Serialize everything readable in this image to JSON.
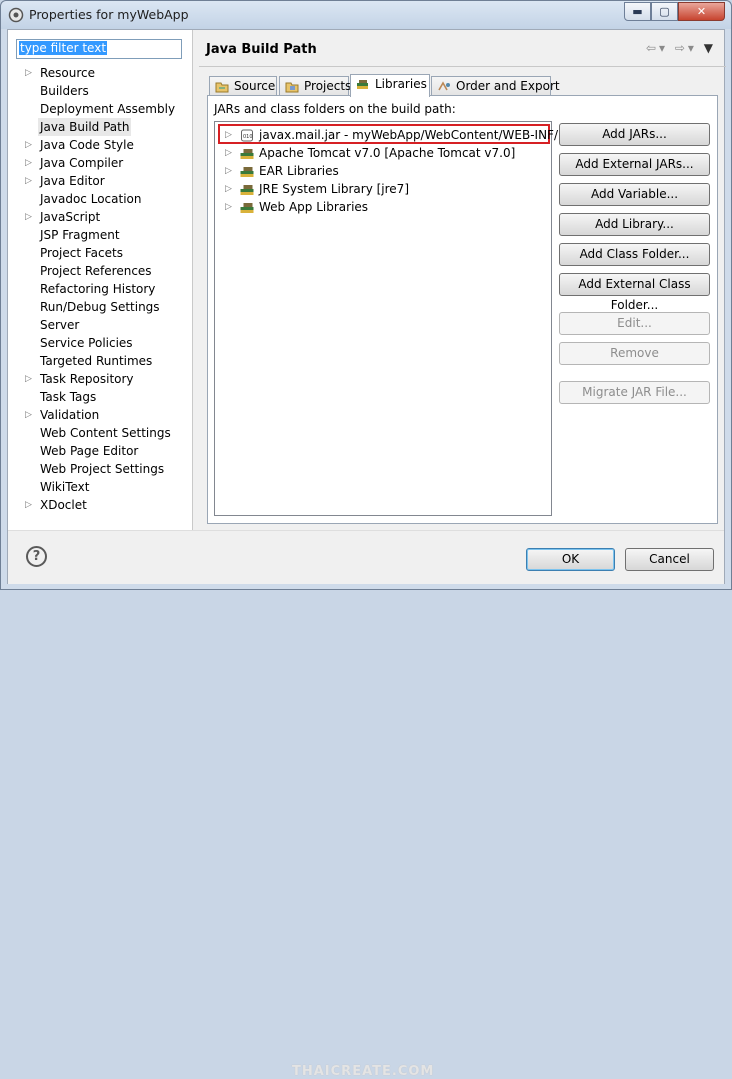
{
  "window": {
    "title": "Properties for myWebApp",
    "min_label": "▬",
    "max_label": "▢",
    "close_label": "✕"
  },
  "filter": {
    "value": "type filter text"
  },
  "tree": {
    "items": [
      {
        "label": "Resource",
        "expandable": true
      },
      {
        "label": "Builders",
        "expandable": false
      },
      {
        "label": "Deployment Assembly",
        "expandable": false
      },
      {
        "label": "Java Build Path",
        "expandable": false,
        "selected": true
      },
      {
        "label": "Java Code Style",
        "expandable": true
      },
      {
        "label": "Java Compiler",
        "expandable": true
      },
      {
        "label": "Java Editor",
        "expandable": true
      },
      {
        "label": "Javadoc Location",
        "expandable": false
      },
      {
        "label": "JavaScript",
        "expandable": true
      },
      {
        "label": "JSP Fragment",
        "expandable": false
      },
      {
        "label": "Project Facets",
        "expandable": false
      },
      {
        "label": "Project References",
        "expandable": false
      },
      {
        "label": "Refactoring History",
        "expandable": false
      },
      {
        "label": "Run/Debug Settings",
        "expandable": false
      },
      {
        "label": "Server",
        "expandable": false
      },
      {
        "label": "Service Policies",
        "expandable": false
      },
      {
        "label": "Targeted Runtimes",
        "expandable": false
      },
      {
        "label": "Task Repository",
        "expandable": true
      },
      {
        "label": "Task Tags",
        "expandable": false
      },
      {
        "label": "Validation",
        "expandable": true
      },
      {
        "label": "Web Content Settings",
        "expandable": false
      },
      {
        "label": "Web Page Editor",
        "expandable": false
      },
      {
        "label": "Web Project Settings",
        "expandable": false
      },
      {
        "label": "WikiText",
        "expandable": false
      },
      {
        "label": "XDoclet",
        "expandable": true
      }
    ]
  },
  "page": {
    "title": "Java Build Path",
    "tabs": [
      {
        "label": "Source",
        "icon": "source-folder-icon"
      },
      {
        "label": "Projects",
        "icon": "projects-folder-icon"
      },
      {
        "label": "Libraries",
        "icon": "libraries-icon",
        "active": true
      },
      {
        "label": "Order and Export",
        "icon": "order-export-icon"
      }
    ],
    "panel_label": "JARs and class folders on the build path:",
    "libraries": [
      {
        "label": "javax.mail.jar - myWebApp/WebContent/WEB-INF/lib",
        "icon": "jar-icon",
        "highlighted": true
      },
      {
        "label": "Apache Tomcat v7.0 [Apache Tomcat v7.0]",
        "icon": "library-icon"
      },
      {
        "label": "EAR Libraries",
        "icon": "library-icon"
      },
      {
        "label": "JRE System Library [jre7]",
        "icon": "library-icon"
      },
      {
        "label": "Web App Libraries",
        "icon": "library-icon"
      }
    ],
    "buttons": [
      {
        "label": "Add JARs...",
        "enabled": true
      },
      {
        "label": "Add External JARs...",
        "enabled": true
      },
      {
        "label": "Add Variable...",
        "enabled": true
      },
      {
        "label": "Add Library...",
        "enabled": true
      },
      {
        "label": "Add Class Folder...",
        "enabled": true
      },
      {
        "label": "Add External Class Folder...",
        "enabled": true
      },
      {
        "label": "Edit...",
        "enabled": false
      },
      {
        "label": "Remove",
        "enabled": false
      },
      {
        "label": "Migrate JAR File...",
        "enabled": false
      }
    ]
  },
  "dialog": {
    "help_label": "?",
    "ok_label": "OK",
    "cancel_label": "Cancel"
  },
  "watermark": "THAICREATE.COM",
  "colors": {
    "highlight_border": "#d62024",
    "selection": "#3399ff"
  }
}
